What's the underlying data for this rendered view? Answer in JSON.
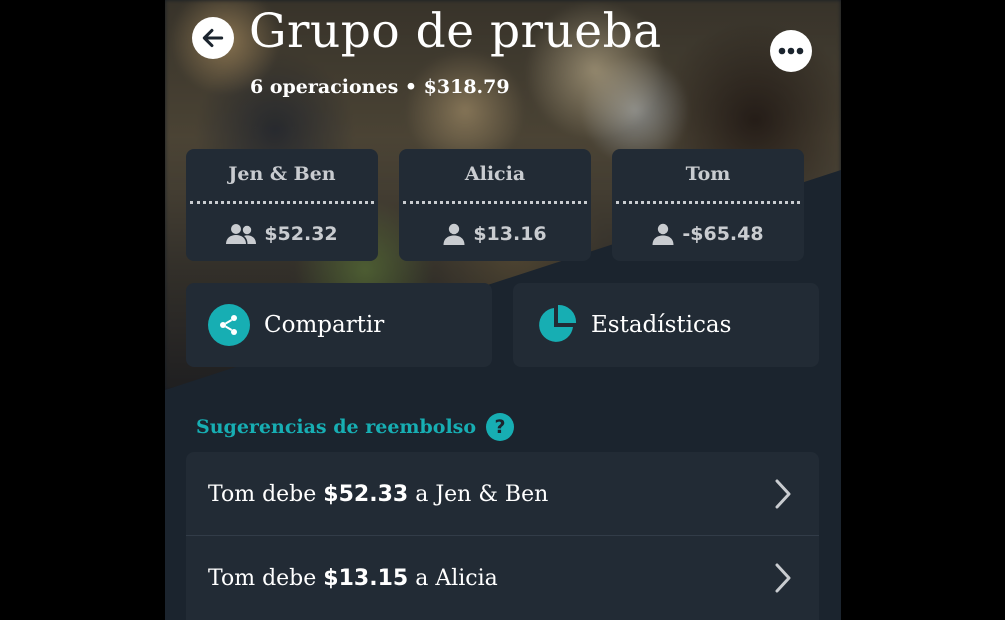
{
  "header": {
    "title": "Grupo de prueba",
    "operations_count": "6 operaciones",
    "separator": "•",
    "total": "$318.79",
    "back_icon": "arrow-left-icon",
    "menu_icon": "more-horizontal-icon"
  },
  "members": [
    {
      "name": "Jen & Ben",
      "balance": "$52.32",
      "icon": "users-icon"
    },
    {
      "name": "Alicia",
      "balance": "$13.16",
      "icon": "user-icon"
    },
    {
      "name": "Tom",
      "balance": "-$65.48",
      "icon": "user-icon"
    }
  ],
  "actions": {
    "share_label": "Compartir",
    "stats_label": "Estadísticas"
  },
  "suggestions": {
    "title": "Sugerencias de reembolso",
    "help_symbol": "?",
    "items": [
      {
        "debtor": "Tom",
        "verb": "debe",
        "amount": "$52.33",
        "prep": "a",
        "creditor": "Jen & Ben"
      },
      {
        "debtor": "Tom",
        "verb": "debe",
        "amount": "$13.15",
        "prep": "a",
        "creditor": "Alicia"
      }
    ]
  },
  "colors": {
    "accent": "#17aeb3",
    "card": "#222b35",
    "background": "#1b242e",
    "muted_text": "#c9ccd0"
  }
}
